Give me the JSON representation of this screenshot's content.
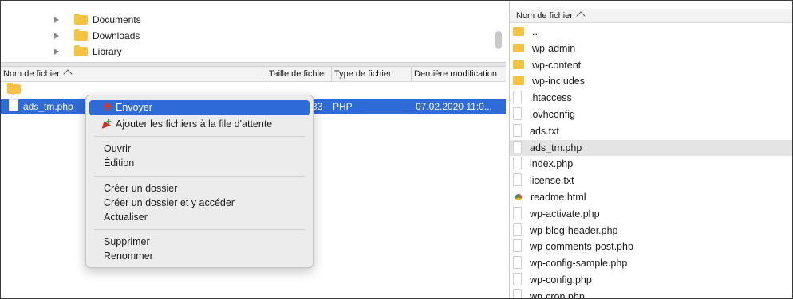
{
  "tree": {
    "items": [
      {
        "label": "Documents"
      },
      {
        "label": "Downloads"
      },
      {
        "label": "Library"
      }
    ]
  },
  "local": {
    "columns": [
      "Nom de fichier",
      "Taille de fichier",
      "Type de fichier",
      "Dernière modification"
    ],
    "rows": [
      {
        "name": "..",
        "size": "",
        "type": "",
        "modified": ""
      },
      {
        "name": "ads_tm.php",
        "size": "33",
        "type": "PHP",
        "modified": "07.02.2020 11:0..."
      }
    ]
  },
  "context_menu": {
    "items": [
      {
        "label": "Envoyer"
      },
      {
        "label": "Ajouter les fichiers à la file d'attente"
      },
      {
        "label": "Ouvrir"
      },
      {
        "label": "Édition"
      },
      {
        "label": "Créer un dossier"
      },
      {
        "label": "Créer un dossier et y accéder"
      },
      {
        "label": "Actualiser"
      },
      {
        "label": "Supprimer"
      },
      {
        "label": "Renommer"
      }
    ]
  },
  "remote": {
    "column": "Nom de fichier",
    "files": [
      {
        "name": "..",
        "kind": "folder"
      },
      {
        "name": "wp-admin",
        "kind": "folder"
      },
      {
        "name": "wp-content",
        "kind": "folder"
      },
      {
        "name": "wp-includes",
        "kind": "folder"
      },
      {
        "name": ".htaccess",
        "kind": "file"
      },
      {
        "name": ".ovhconfig",
        "kind": "file"
      },
      {
        "name": "ads.txt",
        "kind": "file"
      },
      {
        "name": "ads_tm.php",
        "kind": "file"
      },
      {
        "name": "index.php",
        "kind": "file"
      },
      {
        "name": "license.txt",
        "kind": "file"
      },
      {
        "name": "readme.html",
        "kind": "html"
      },
      {
        "name": "wp-activate.php",
        "kind": "file"
      },
      {
        "name": "wp-blog-header.php",
        "kind": "file"
      },
      {
        "name": "wp-comments-post.php",
        "kind": "file"
      },
      {
        "name": "wp-config-sample.php",
        "kind": "file"
      },
      {
        "name": "wp-config.php",
        "kind": "file"
      },
      {
        "name": "wp-cron.php",
        "kind": "file"
      }
    ]
  },
  "colors": {
    "selection": "#2f6ad9",
    "folder": "#f5c242",
    "upload_arrow": "#d23b2a"
  }
}
